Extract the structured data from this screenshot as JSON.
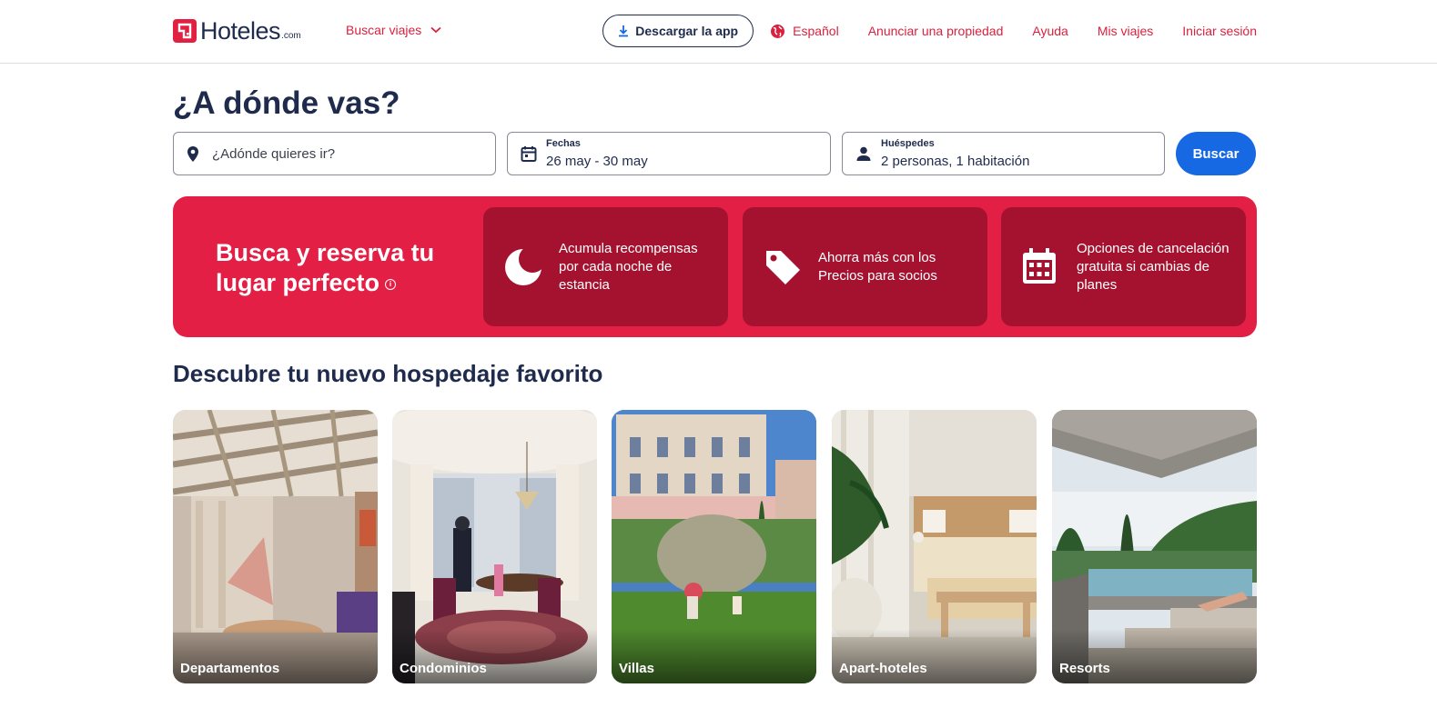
{
  "header": {
    "logo_text": "Hoteles",
    "logo_suffix": ".com",
    "trip_menu": "Buscar viajes",
    "download_app": "Descargar la app",
    "language": "Español",
    "list_property": "Anunciar una propiedad",
    "help": "Ayuda",
    "my_trips": "Mis viajes",
    "sign_in": "Iniciar sesión"
  },
  "search": {
    "title": "¿A dónde vas?",
    "destination_placeholder": "¿Adónde quieres ir?",
    "dates_label": "Fechas",
    "dates_value": "26 may - 30 may",
    "guests_label": "Huéspedes",
    "guests_value": "2 personas, 1 habitación",
    "submit": "Buscar"
  },
  "banner": {
    "title": "Busca y reserva tu lugar perfecto",
    "info_icon": "i",
    "benefits": [
      {
        "icon": "moon-icon",
        "text": "Acumula recompensas por cada noche de estancia"
      },
      {
        "icon": "tag-icon",
        "text": "Ahorra más con los Precios para socios"
      },
      {
        "icon": "calendar-icon",
        "text": "Opciones de cancelación gratuita si cambias de planes"
      }
    ]
  },
  "discover": {
    "title": "Descubre tu nuevo hospedaje favorito",
    "cards": [
      {
        "label": "Departamentos"
      },
      {
        "label": "Condominios"
      },
      {
        "label": "Villas"
      },
      {
        "label": "Apart-hoteles"
      },
      {
        "label": "Resorts"
      }
    ]
  },
  "colors": {
    "brand_red": "#e41f45",
    "benefit_dark": "#a5122f",
    "link_red": "#d8223f",
    "primary_blue": "#1668e3",
    "text_navy": "#1f2b4d"
  }
}
